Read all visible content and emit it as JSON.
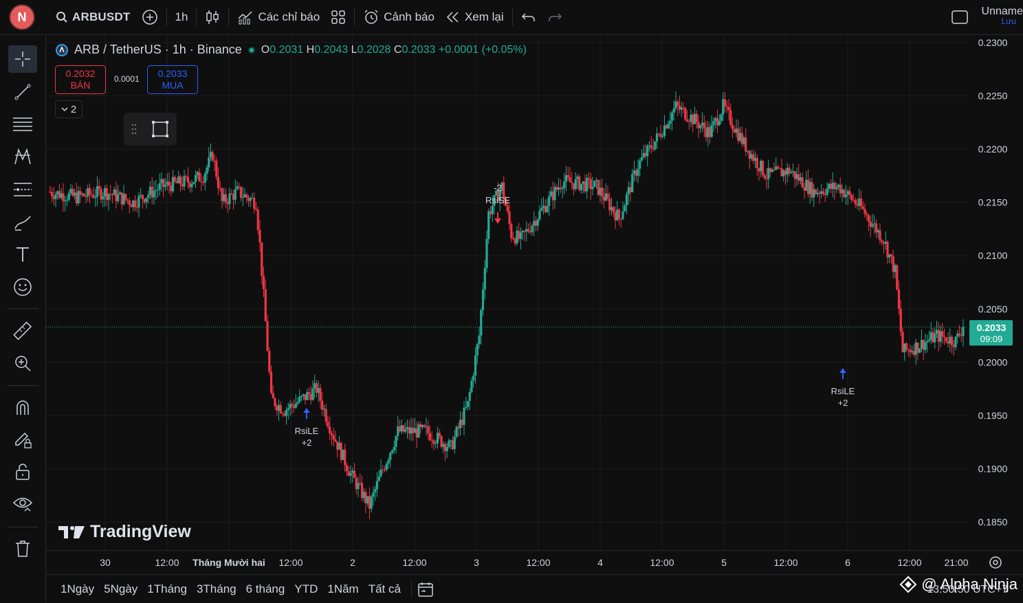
{
  "topbar": {
    "avatar_letter": "N",
    "symbol": "ARBUSDT",
    "interval": "1h",
    "indicators_label": "Các chỉ báo",
    "alert_label": "Cảnh báo",
    "replay_label": "Xem lại",
    "layout_name": "Unname",
    "save_label": "Lưu"
  },
  "legend": {
    "title": "ARB / TetherUS · 1h · Binance",
    "o_label": "O",
    "o": "0.2031",
    "h_label": "H",
    "h": "0.2043",
    "l_label": "L",
    "l": "0.2028",
    "c_label": "C",
    "c": "0.2033",
    "change": "+0.0001 (+0.05%)"
  },
  "trade": {
    "sell_price": "0.2032",
    "sell_label": "BÁN",
    "spread": "0.0001",
    "buy_price": "0.2033",
    "buy_label": "MUA",
    "collapse_count": "2"
  },
  "price_axis": {
    "labels": [
      "0.2300",
      "0.2250",
      "0.2200",
      "0.2150",
      "0.2100",
      "0.2050",
      "0.2000",
      "0.1950",
      "0.1900",
      "0.1850"
    ],
    "current_price": "0.2033",
    "countdown": "09:09"
  },
  "time_axis": {
    "labels": [
      "30",
      "12:00",
      "Tháng Mười hai",
      "12:00",
      "2",
      "12:00",
      "3",
      "12:00",
      "4",
      "12:00",
      "5",
      "12:00",
      "6",
      "12:00",
      "21:00"
    ]
  },
  "signals": [
    {
      "top": "",
      "bottom": "RsiLE",
      "extra": "+2"
    },
    {
      "top": "-2",
      "bottom": "RsiSE",
      "extra": ""
    },
    {
      "top": "",
      "bottom": "RsiLE",
      "extra": "+2"
    }
  ],
  "branding": {
    "logo_text": "TradingView"
  },
  "bottombar": {
    "ranges": [
      "1Ngày",
      "5Ngày",
      "1Tháng",
      "3Tháng",
      "6 tháng",
      "YTD",
      "1Năm",
      "Tất cả"
    ]
  },
  "watermark": {
    "text": "@ Alpha Ninja",
    "clock": "13:50:50 UTC+7"
  },
  "colors": {
    "up": "#22ab94",
    "down": "#f23645",
    "background": "#0f0f0f",
    "accent": "#2962ff"
  }
}
